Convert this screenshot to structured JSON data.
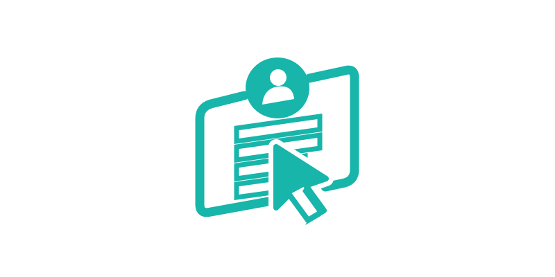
{
  "illustration": {
    "name": "user-profile-form-click-icon",
    "accent_color": "#17B5AA",
    "background_color": "#FFFFFF",
    "parts": [
      "window-frame-icon",
      "user-avatar-icon",
      "form-lines-icon",
      "mouse-cursor-icon"
    ]
  }
}
